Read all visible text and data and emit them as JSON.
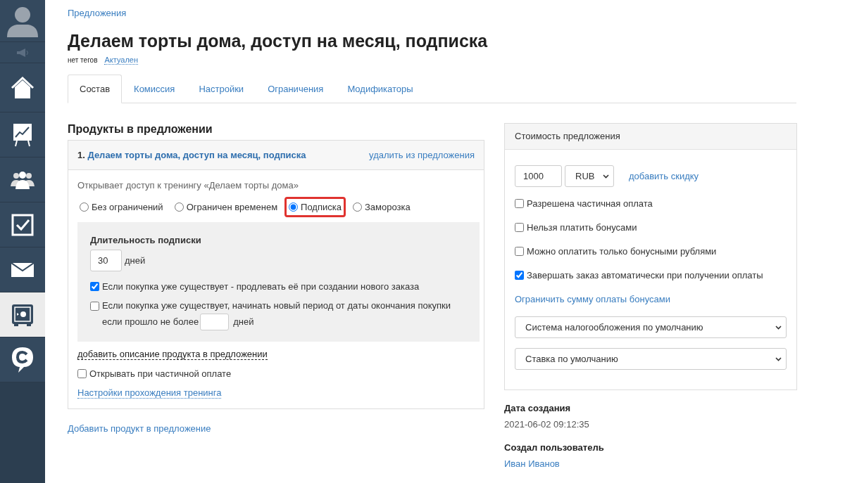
{
  "sidebar": {
    "items": [
      {
        "kind": "avatar",
        "selected": false
      },
      {
        "kind": "megaphone",
        "selected": false
      },
      {
        "kind": "home",
        "selected": false
      },
      {
        "kind": "chart",
        "selected": false
      },
      {
        "kind": "people",
        "selected": false
      },
      {
        "kind": "tasks",
        "selected": false
      },
      {
        "kind": "mail",
        "selected": false
      },
      {
        "kind": "safe",
        "selected": true
      },
      {
        "kind": "chat",
        "selected": false
      }
    ]
  },
  "breadcrumb": "Предложения",
  "title": "Делаем торты дома, доступ на месяц, подписка",
  "tags": {
    "label": "нет тегов",
    "status": "Актуален"
  },
  "tabs": [
    {
      "label": "Состав",
      "selected": true
    },
    {
      "label": "Комиссия",
      "selected": false
    },
    {
      "label": "Настройки",
      "selected": false
    },
    {
      "label": "Ограничения",
      "selected": false
    },
    {
      "label": "Модификаторы",
      "selected": false
    }
  ],
  "products": {
    "heading": "Продукты в предложении",
    "items": [
      {
        "number": "1.",
        "name": "Делаем торты дома, доступ на месяц, подписка",
        "remove": "удалить из предложения",
        "description": "Открывает доступ к тренингу «Делаем торты дома»",
        "access_options": [
          {
            "label": "Без ограничений",
            "selected": false,
            "highlighted": false
          },
          {
            "label": "Ограничен временем",
            "selected": false,
            "highlighted": false
          },
          {
            "label": "Подписка",
            "selected": true,
            "highlighted": true
          },
          {
            "label": "Заморозка",
            "selected": false,
            "highlighted": false
          }
        ],
        "subscription": {
          "heading": "Длительность подписки",
          "duration": "30",
          "unit": "дней",
          "extend": {
            "label": "Если покупка уже существует - продлевать её при создании нового заказа",
            "checked": true
          },
          "new_period": {
            "label": "Если покупка уже существует, начинать новый период от даты окончания покупки",
            "label_2": "если прошло не более",
            "unit": "дней",
            "checked": false
          }
        },
        "add_description": "добавить описание продукта в предложении",
        "open_partial": {
          "label": "Открывать при частичной оплате",
          "checked": false
        },
        "training_settings": "Настройки прохождения тренинга"
      }
    ],
    "add_product": "Добавить продукт в предложение"
  },
  "price": {
    "heading": "Стоимость предложения",
    "amount": "1000",
    "currency": "RUB",
    "discount": "добавить скидку",
    "options": [
      {
        "label": "Разрешена частичная оплата",
        "checked": false
      },
      {
        "label": "Нельзя платить бонусами",
        "checked": false
      },
      {
        "label": "Можно оплатить только бонусными рублями",
        "checked": false
      },
      {
        "label": "Завершать заказ автоматически при получении оплаты",
        "checked": true
      }
    ],
    "limit_bonus": "Ограничить сумму оплаты бонусами",
    "tax_system": "Система налогообложения по умолчанию",
    "tax_rate": "Ставка по умолчанию"
  },
  "meta": [
    {
      "label": "Дата создания",
      "value": "2021-06-02 09:12:35",
      "kind": "text"
    },
    {
      "label": "Создал пользователь",
      "value": "Иван Иванов",
      "kind": "link"
    }
  ]
}
